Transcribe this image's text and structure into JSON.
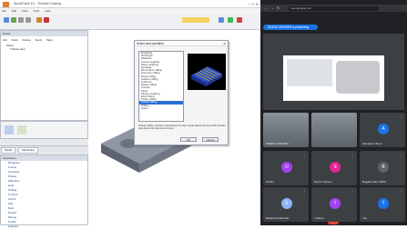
{
  "cam": {
    "title": "SprutCAM 10 - Turbine Casing",
    "menu": [
      "File",
      "Edit",
      "View",
      "Tools",
      "Help"
    ],
    "pane_top_title": "Model",
    "tabs": [
      "Job",
      "Tools",
      "Fixture",
      "Stock",
      "Parts"
    ],
    "tree_items": [
      "Setup",
      "Turbine.step"
    ],
    "pane_bot_title": "Operations",
    "left_tabs": [
      "Model",
      "Machining"
    ],
    "ops": [
      "Roughing",
      "Z-level",
      "Finishing",
      "Pocket",
      "Waterline",
      "Hole",
      "Drilling",
      "Contour",
      "Pencil",
      "Flat",
      "Rest",
      "Project",
      "Plunge",
      "Profile",
      "Engrave"
    ]
  },
  "dialog": {
    "title": "Select new operation",
    "list": [
      "Roughing",
      "3D Rough",
      "Waterline",
      "Z-level roughing",
      "Plane roughing",
      "Finishing",
      "3D Contour milling",
      "Drive line milling",
      "Pencil milling",
      "Surface milling",
      "Undercut",
      "Rotary milling",
      "Contour",
      "Stock",
      "Plunge roughing",
      "Rest milling",
      "Profile milling",
      "Pocket milling",
      "Drilling",
      "Holes"
    ],
    "selected_index": 17,
    "description": "Pocket milling: removes material layer by layer inside closed contours with constant step down and optional rest stock.",
    "ok": "OK",
    "cancel": "Cancel"
  },
  "meet": {
    "url": "meet.google.com",
    "presenting": "INDRIS GRENIER is presenting",
    "participants": [
      {
        "name": "INDRIS GRENIER",
        "initial": "",
        "color": "#5f6368",
        "video": true
      },
      {
        "name": "",
        "initial": "",
        "color": "#5f6368",
        "video": true
      },
      {
        "name": "Alexandru Toma",
        "initial": "A",
        "color": "#1a73e8",
        "video": false
      },
      {
        "name": "Ovidiu",
        "initial": "O",
        "color": "#a142f4",
        "video": false
      },
      {
        "name": "Sinziz Carmen",
        "initial": "S",
        "color": "#e52592",
        "video": false
      },
      {
        "name": "Bogdan Ioan POPA",
        "initial": "B",
        "color": "#5f6368",
        "video": false
      },
      {
        "name": "Eduard Iordanovits",
        "initial": "E",
        "color": "#8ab4f8",
        "video": false
      },
      {
        "name": "T.elbero",
        "initial": "T",
        "color": "#a142f4",
        "video": false
      },
      {
        "name": "You",
        "initial": "T",
        "color": "#1a73e8",
        "video": false
      }
    ]
  }
}
